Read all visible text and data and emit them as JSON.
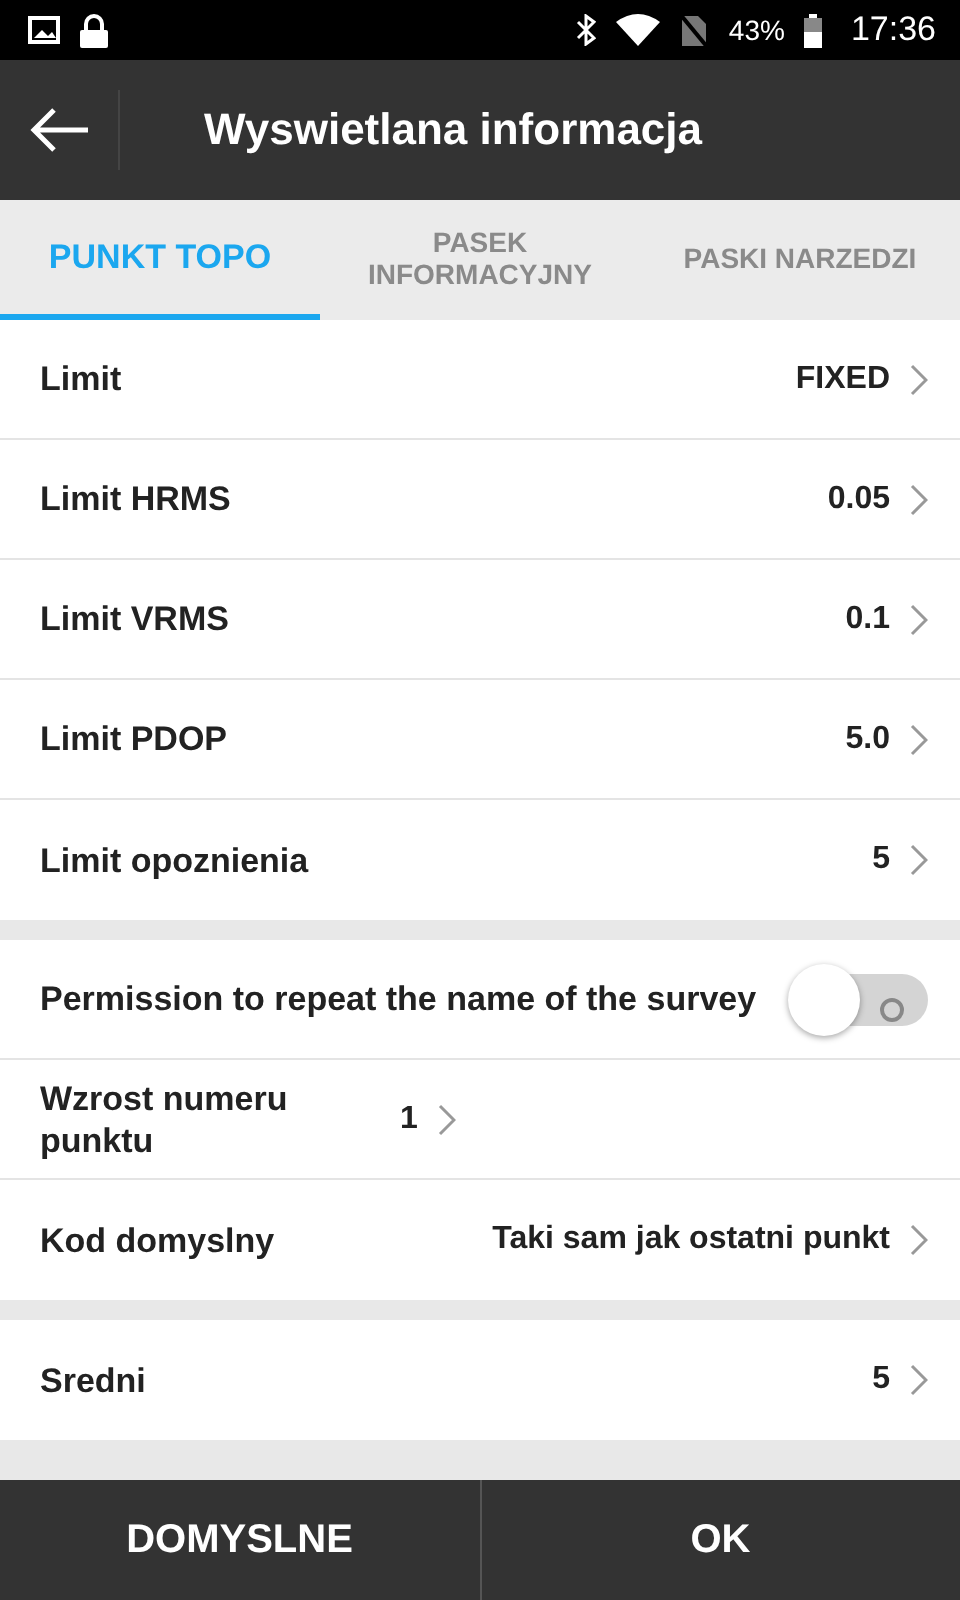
{
  "status_bar": {
    "battery": "43%",
    "time": "17:36"
  },
  "toolbar": {
    "title": "Wyswietlana informacja"
  },
  "tabs": [
    {
      "label": "PUNKT TOPO",
      "selected": true
    },
    {
      "label": "PASEK INFORMACYJNY",
      "selected": false
    },
    {
      "label": "PASKI NARZEDZI",
      "selected": false
    }
  ],
  "sections": [
    {
      "rows": [
        {
          "kind": "value",
          "label": "Limit",
          "value": "FIXED"
        },
        {
          "kind": "value",
          "label": "Limit HRMS",
          "value": "0.05"
        },
        {
          "kind": "value",
          "label": "Limit VRMS",
          "value": "0.1"
        },
        {
          "kind": "value",
          "label": "Limit PDOP",
          "value": "5.0"
        },
        {
          "kind": "value",
          "label": "Limit opoznienia",
          "value": "5"
        }
      ]
    },
    {
      "rows": [
        {
          "kind": "toggle",
          "label": "Permission to repeat the name of the survey",
          "on": false
        },
        {
          "kind": "value",
          "label": "Wzrost numeru punktu",
          "value": "1"
        },
        {
          "kind": "value",
          "label": "Kod domyslny",
          "value": "Taki sam jak ostatni punkt"
        }
      ]
    },
    {
      "rows": [
        {
          "kind": "value",
          "label": "Sredni",
          "value": "5"
        }
      ]
    }
  ],
  "buttons": [
    "DOMYSLNE",
    "OK"
  ]
}
